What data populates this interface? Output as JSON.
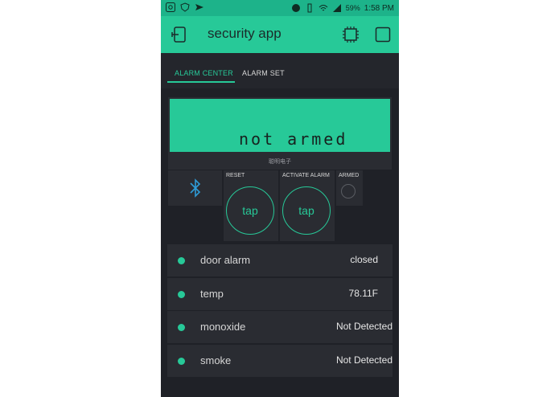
{
  "status_bar": {
    "battery": "59%",
    "time": "1:58 PM"
  },
  "app": {
    "title": "security app"
  },
  "tabs": [
    {
      "label": "ALARM CENTER",
      "active": true
    },
    {
      "label": "ALARM SET",
      "active": false
    }
  ],
  "lcd": {
    "line1": "",
    "line2": "not armed",
    "caption": "聪明电子"
  },
  "controls": {
    "bluetooth_icon": "bluetooth-icon",
    "reset": {
      "label": "RESET",
      "button": "tap"
    },
    "activate": {
      "label": "ACTIVATE ALARM",
      "button": "tap"
    },
    "armed": {
      "label": "ARMED",
      "state": "off"
    }
  },
  "values": [
    {
      "label": "door alarm",
      "value": "closed"
    },
    {
      "label": "temp",
      "value": "78.11F"
    },
    {
      "label": "monoxide",
      "value": "Not Detected"
    },
    {
      "label": "smoke",
      "value": "Not Detected"
    }
  ],
  "colors": {
    "accent": "#27c998",
    "background": "#1f2127",
    "widget": "#2a2c32"
  }
}
